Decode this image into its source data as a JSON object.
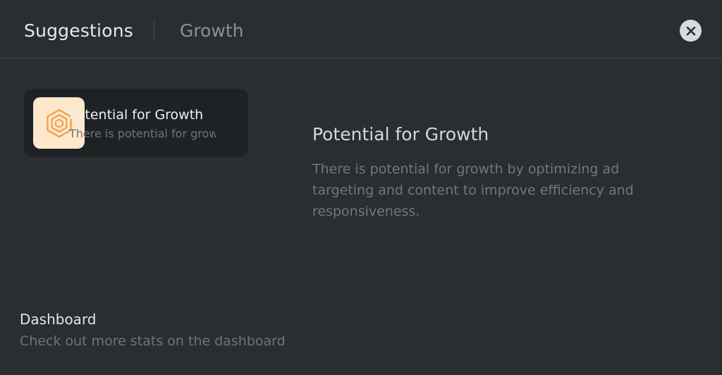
{
  "header": {
    "title": "Suggestions",
    "subtitle": "Growth",
    "close_icon": "close-icon"
  },
  "suggestions": [
    {
      "icon": "hexagon-icon",
      "title": "Potential for Growth",
      "description": "There is potential for growth by optimizing ad targeting and content to improve efficiency and responsiveness."
    }
  ],
  "detail": {
    "title": "Potential for Growth",
    "description": "There is potential for growth by optimizing ad targeting and content to improve efficiency and responsiveness."
  },
  "footer": {
    "title": "Dashboard",
    "description": "Check out more stats on the dashboard"
  },
  "colors": {
    "background": "#2a2d31",
    "card_background": "#1f2225",
    "icon_background": "#fde8cc",
    "icon_accent": "#f0a04b"
  }
}
